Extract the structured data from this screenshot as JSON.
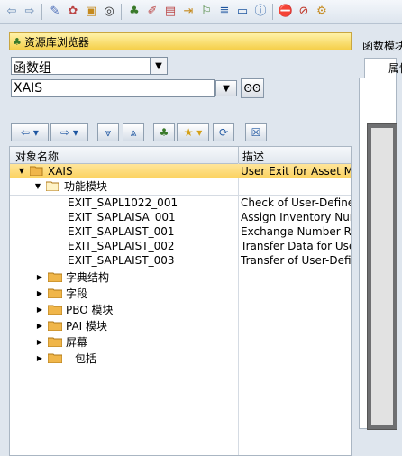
{
  "titlebar": {
    "title": "资源库浏览器"
  },
  "selector": {
    "value": "函数组"
  },
  "search": {
    "value": "XAIS"
  },
  "tree": {
    "header": {
      "col1": "对象名称",
      "col2": "描述"
    },
    "root": {
      "label": "XAIS",
      "desc": "User Exit for Asset Mas"
    },
    "group": {
      "label": "功能模块"
    },
    "functions": [
      {
        "name": "EXIT_SAPL1022_001",
        "desc": "Check of User-Defined"
      },
      {
        "name": "EXIT_SAPLAISA_001",
        "desc": "Assign Inventory Numb"
      },
      {
        "name": "EXIT_SAPLAIST_001",
        "desc": "Exchange Number Ran"
      },
      {
        "name": "EXIT_SAPLAIST_002",
        "desc": "Transfer Data for User"
      },
      {
        "name": "EXIT_SAPLAIST_003",
        "desc": "Transfer of User-Define"
      }
    ],
    "folders": [
      "字典结构",
      "字段",
      "PBO 模块",
      "PAI 模块",
      "屏幕",
      "包括"
    ]
  },
  "right": {
    "label": "函数模块",
    "tab": "属性"
  },
  "colors": {
    "highlight": "#fbd25f",
    "folder": "#f0b64a",
    "panel": "#dfe6ee"
  },
  "icons": [
    "back-icon",
    "forward-icon",
    "edit-icon",
    "activate-icon",
    "object-icon",
    "display-object-icon",
    "where-used-icon",
    "hierarchy-icon",
    "navigate-icon",
    "info-icon",
    "settings-icon",
    "help-icon"
  ]
}
